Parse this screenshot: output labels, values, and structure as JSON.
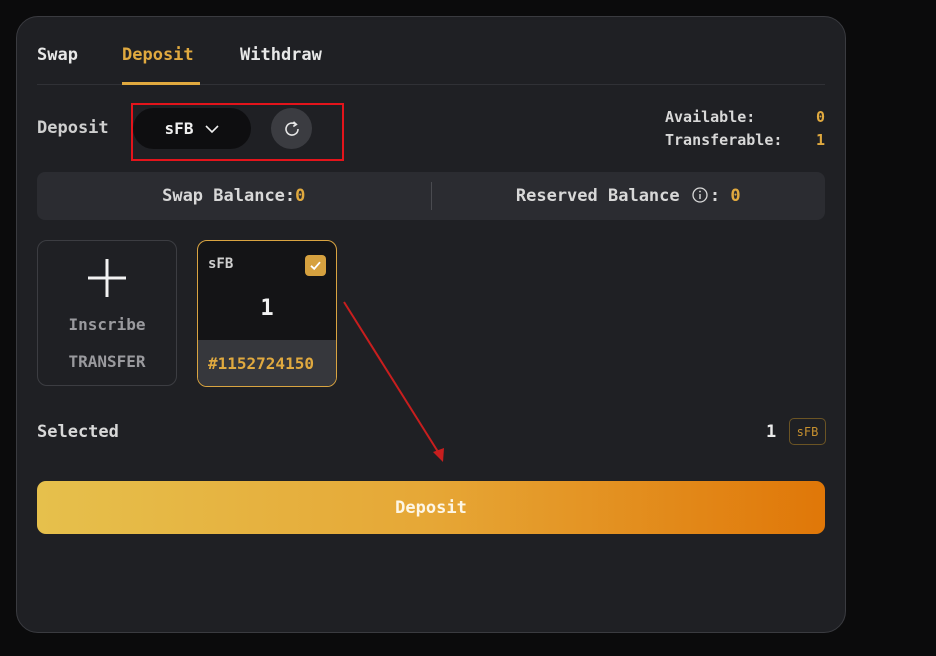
{
  "tabs": [
    {
      "label": "Swap",
      "active": false
    },
    {
      "label": "Deposit",
      "active": true
    },
    {
      "label": "Withdraw",
      "active": false
    }
  ],
  "deposit_row": {
    "label": "Deposit",
    "token": "sFB",
    "available_label": "Available:",
    "available_value": "0",
    "transferable_label": "Transferable:",
    "transferable_value": "1"
  },
  "balances": {
    "swap_label": "Swap Balance:",
    "swap_value": "0",
    "reserved_label": "Reserved Balance",
    "reserved_value": "0"
  },
  "inscribe_card": {
    "line1": "Inscribe",
    "line2": "TRANSFER"
  },
  "inscription": {
    "ticker": "sFB",
    "amount": "1",
    "id": "#1152724150",
    "checked": true
  },
  "selected": {
    "label": "Selected",
    "amount": "1",
    "token": "sFB"
  },
  "action": {
    "deposit_label": "Deposit"
  },
  "colors": {
    "accent": "#e0a93f",
    "panel": "#1f2024",
    "highlight": "#e3141b",
    "annotation_arrow": "#c81e1e"
  },
  "icons": [
    "chevron-down-icon",
    "refresh-icon",
    "info-icon",
    "plus-icon",
    "checkmark-icon",
    "arrow-annotation"
  ]
}
